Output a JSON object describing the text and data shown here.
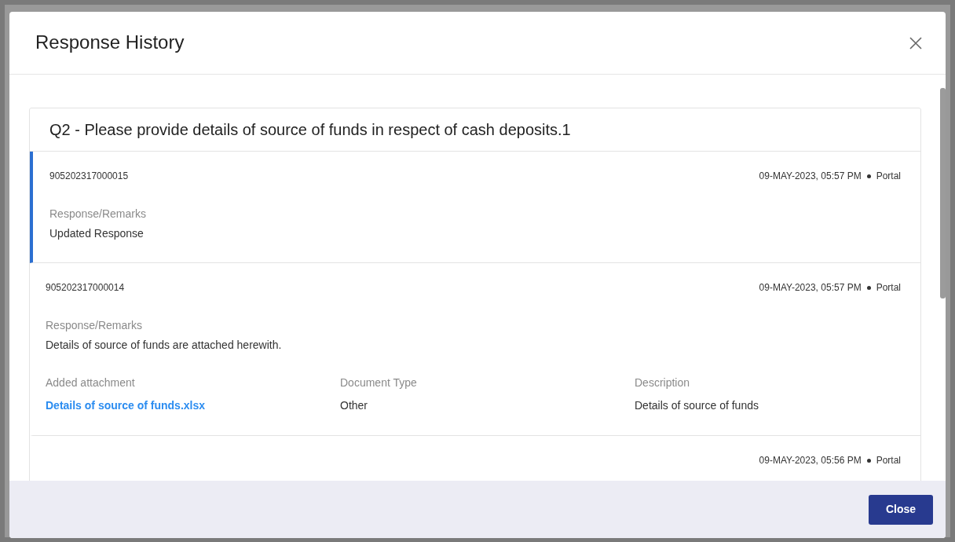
{
  "modal": {
    "title": "Response History",
    "close_label": "Close",
    "question": "Q2 - Please provide details of source of funds in respect of cash deposits.1",
    "responses": [
      {
        "id": "905202317000015",
        "timestamp": "09-MAY-2023, 05:57 PM",
        "source": "Portal",
        "selected": true,
        "remarks_label": "Response/Remarks",
        "remarks": "Updated Response"
      },
      {
        "id": "905202317000014",
        "timestamp": "09-MAY-2023, 05:57 PM",
        "source": "Portal",
        "selected": false,
        "remarks_label": "Response/Remarks",
        "remarks": "Details of source of funds are attached herewith.",
        "attachment": {
          "label": "Added attachment",
          "file": "Details of source of funds.xlsx",
          "type_label": "Document Type",
          "type": "Other",
          "description_label": "Description",
          "description": "Details of source of funds"
        }
      },
      {
        "timestamp": "09-MAY-2023, 05:56 PM",
        "source": "Portal",
        "selected": false
      }
    ]
  }
}
